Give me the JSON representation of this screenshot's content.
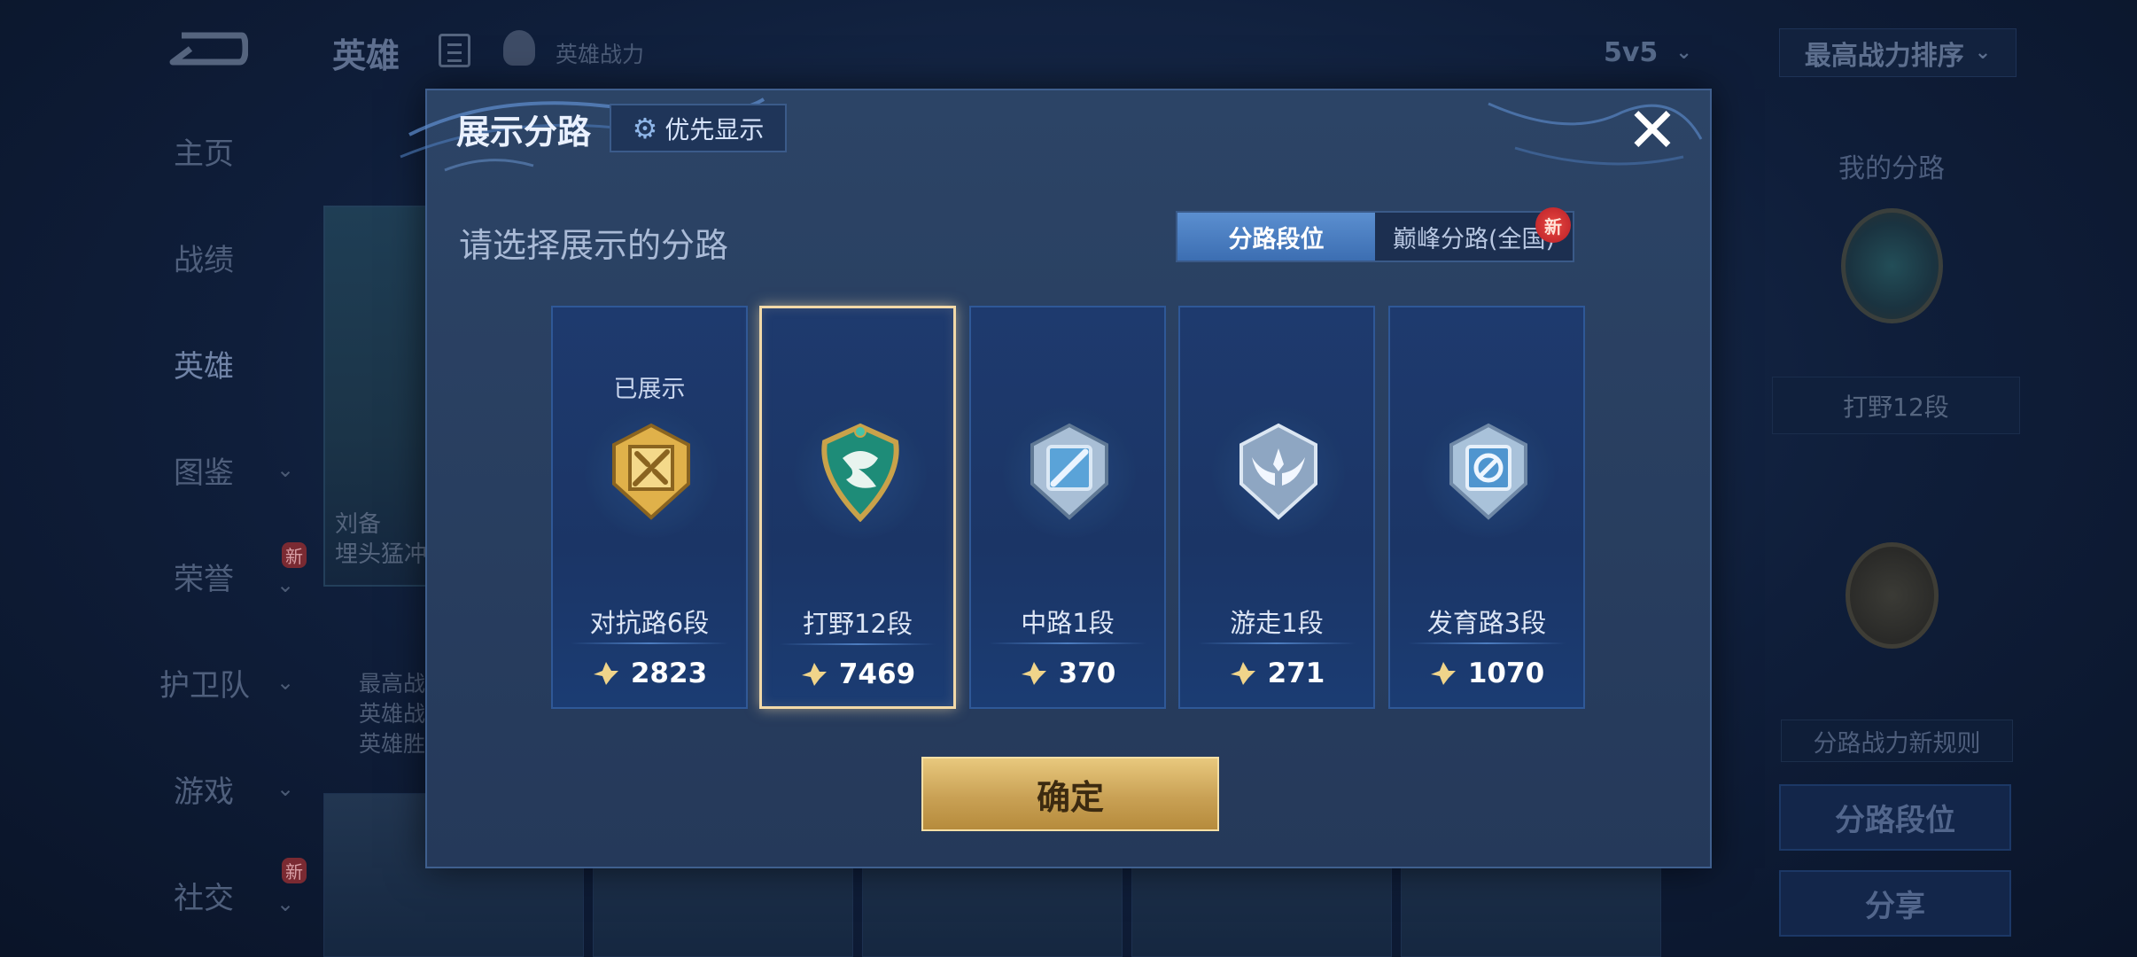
{
  "background": {
    "top_title": "英雄",
    "top_subtitle": "英雄战力",
    "mode_value": "5v5",
    "sort_value": "最高战力排序",
    "nav": [
      {
        "label": "主页",
        "has_chevron": false
      },
      {
        "label": "战绩",
        "has_chevron": false
      },
      {
        "label": "英雄",
        "has_chevron": false,
        "active": true
      },
      {
        "label": "图鉴",
        "has_chevron": true
      },
      {
        "label": "荣誉",
        "has_chevron": true,
        "badge": "新"
      },
      {
        "label": "护卫队",
        "has_chevron": true
      },
      {
        "label": "游戏",
        "has_chevron": true
      },
      {
        "label": "社交",
        "has_chevron": true,
        "badge": "新"
      }
    ],
    "hero_card_name_1": "刘备",
    "hero_card_name_2": "埋头猛冲",
    "hero_info": [
      "最高战",
      "英雄战",
      "英雄胜"
    ],
    "right_panel": {
      "title": "我的分路",
      "lane_label": "打野12段",
      "rule_label": "分路战力新规则",
      "lane_rank_button": "分路段位",
      "share_button": "分享"
    }
  },
  "modal": {
    "title": "展示分路",
    "priority_button": "优先显示",
    "subtitle": "请选择展示的分路",
    "tabs": [
      {
        "label": "分路段位",
        "active": true
      },
      {
        "label": "巅峰分路(全国)",
        "active": false,
        "badge": "新"
      }
    ],
    "lanes": [
      {
        "name": "对抗路6段",
        "power": "2823",
        "shown_label": "已展示",
        "icon": "clash-lane-icon",
        "color": "#d9a93f",
        "selected": false
      },
      {
        "name": "打野12段",
        "power": "7469",
        "shown_label": "",
        "icon": "jungle-dragon-icon",
        "color": "#1f8a7a",
        "selected": true
      },
      {
        "name": "中路1段",
        "power": "370",
        "shown_label": "",
        "icon": "mid-lane-icon",
        "color": "#9fb8d4",
        "selected": false
      },
      {
        "name": "游走1段",
        "power": "271",
        "shown_label": "",
        "icon": "roam-wings-icon",
        "color": "#a8bcd4",
        "selected": false
      },
      {
        "name": "发育路3段",
        "power": "1070",
        "shown_label": "",
        "icon": "farm-lane-icon",
        "color": "#a8c4dc",
        "selected": false
      }
    ],
    "confirm_button": "确定"
  },
  "colors": {
    "accent_gold": "#e8c87d",
    "tab_active": "#4a7ec2",
    "modal_bg": "#2a4163",
    "selected_border": "#f2d9a8"
  }
}
